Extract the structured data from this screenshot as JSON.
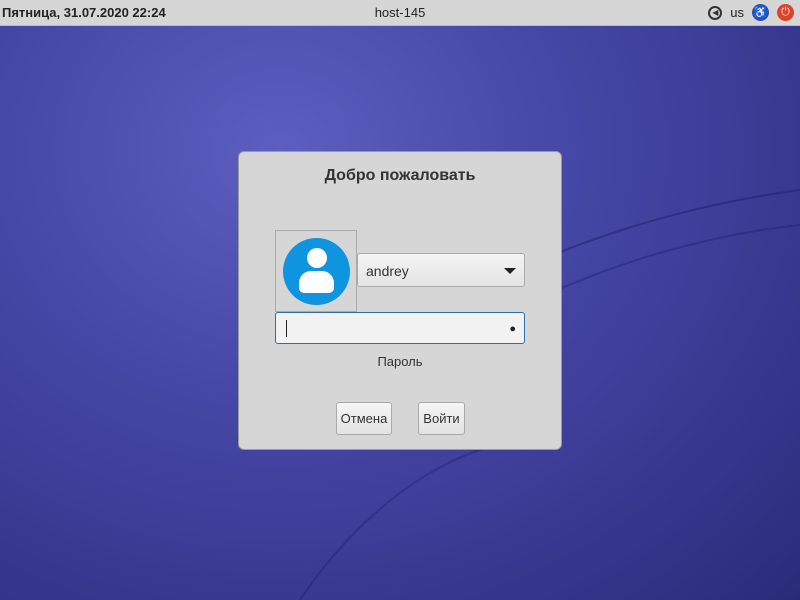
{
  "topbar": {
    "datetime": "Пятница, 31.07.2020 22:24",
    "hostname": "host-145",
    "keyboard_layout": "us"
  },
  "dialog": {
    "title": "Добро пожаловать",
    "user": "andrey",
    "password_value": "",
    "password_label": "Пароль",
    "cancel_label": "Отмена",
    "login_label": "Войти"
  }
}
